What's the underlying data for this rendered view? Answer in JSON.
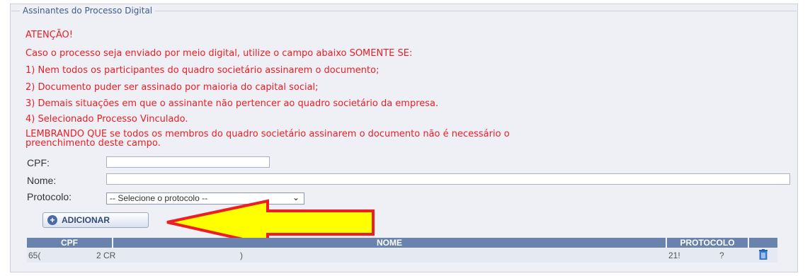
{
  "fieldset": {
    "title": "Assinantes do Processo Digital"
  },
  "warning": {
    "heading": "ATENÇÃO!",
    "intro": "Caso o processo seja enviado por meio digital, utilize o campo abaixo SOMENTE SE:",
    "items": [
      "1) Nem todos os participantes do quadro societário assinarem o documento;",
      "2) Documento puder ser assinado por maioria do capital social;",
      "3) Demais situações em que o assinante não pertencer ao quadro societário da empresa.",
      "4) Selecionado Processo Vinculado."
    ],
    "reminder_line1": "LEMBRANDO QUE se todos os membros do quadro societário assinarem o documento não é necessário o",
    "reminder_line2": "preenchimento deste campo."
  },
  "form": {
    "cpf_label": "CPF:",
    "cpf_value": "",
    "nome_label": "Nome:",
    "nome_value": "",
    "protocolo_label": "Protocolo:",
    "protocolo_selected": "-- Selecione o protocolo --"
  },
  "add_button": {
    "label": "ADICIONAR"
  },
  "table": {
    "headers": [
      "CPF",
      "NOME",
      "PROTOCOLO"
    ],
    "row": {
      "cpf": "65(",
      "cpf_tail": "2",
      "nome": "CR",
      "nome_tail": ")",
      "protocolo": "21!",
      "protocolo_tail": "?"
    }
  },
  "colors": {
    "warning": "#ee1d24",
    "legend": "#3e5b92",
    "header": "#6a83ad",
    "arrow_fill": "#ffff00",
    "arrow_stroke": "#ee1d24"
  }
}
